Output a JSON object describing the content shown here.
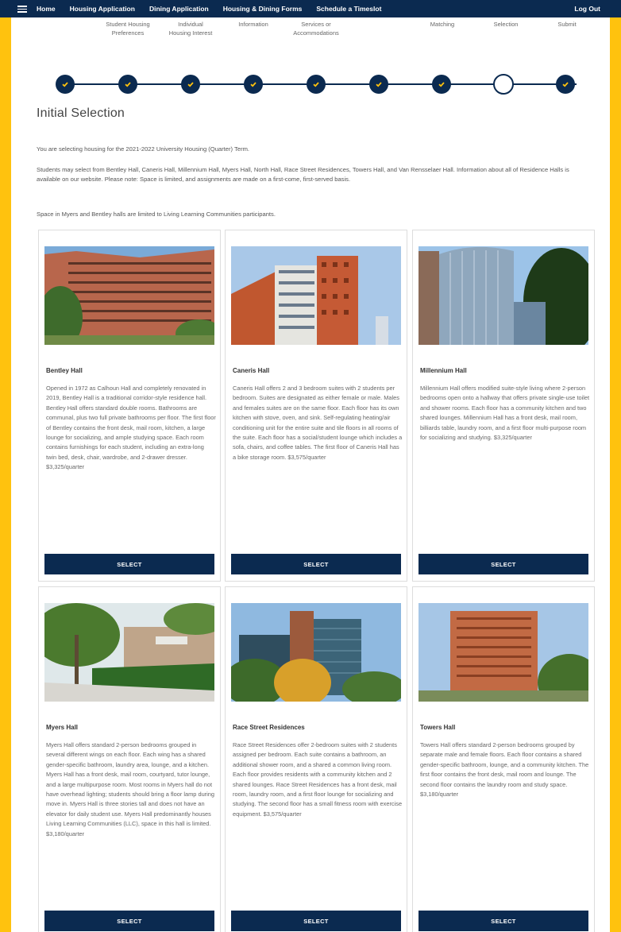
{
  "nav": {
    "links": [
      "Home",
      "Housing Application",
      "Dining Application",
      "Housing & Dining Forms",
      "Schedule a Timeslot"
    ],
    "logout": "Log Out"
  },
  "steps": {
    "labels": [
      "Student Housing Preferences",
      "Individual Housing Interest",
      "Information",
      "Services or Accommodations",
      "Matching",
      "Selection",
      "Submit"
    ]
  },
  "page": {
    "title": "Initial Selection",
    "para1": "You are selecting housing for the 2021-2022 University Housing (Quarter) Term.",
    "para2": "Students may select from Bentley Hall, Caneris Hall, Millennium Hall, Myers Hall, North Hall, Race Street Residences, Towers Hall, and Van Rensselaer Hall. Information about all of Residence Halls is available on our website. Please note: Space is limited, and assignments are made on a first-come, first-served basis.",
    "para3": "Space in Myers and Bentley halls are limited to Living Learning Communities participants."
  },
  "halls": [
    {
      "name": "Bentley Hall",
      "desc": "Opened in 1972 as Calhoun Hall and completely renovated in 2019, Bentley Hall is a traditional corridor-style residence hall. Bentley Hall offers standard double rooms. Bathrooms are communal, plus two full private bathrooms per floor. The first floor of Bentley contains the front desk, mail room, kitchen, a large lounge for socializing, and ample studying space. Each room contains furnishings for each student, including an extra-long twin bed, desk, chair, wardrobe, and 2-drawer dresser. $3,325/quarter",
      "button": "SELECT"
    },
    {
      "name": "Caneris Hall",
      "desc": "Caneris Hall offers 2 and 3 bedroom suites with 2 students per bedroom. Suites are designated as either female or male. Males and females suites are on the same floor. Each floor has its own kitchen with stove, oven, and sink. Self-regulating heating/air conditioning unit for the entire suite and tile floors in all rooms of the suite. Each floor has a social/student lounge which includes a sofa, chairs, and coffee tables. The first floor of Caneris Hall has a bike storage room. $3,575/quarter",
      "button": "SELECT"
    },
    {
      "name": "Millennium Hall",
      "desc": "Millennium Hall offers modified suite-style living where 2-person bedrooms open onto a hallway that offers private single-use toilet and shower rooms. Each floor has a community kitchen and two shared lounges. Millennium Hall has a front desk, mail room, billiards table, laundry room, and a first floor multi-purpose room for socializing and studying. $3,325/quarter",
      "button": "SELECT"
    },
    {
      "name": "Myers Hall",
      "desc": "Myers Hall offers standard 2-person bedrooms grouped in several different wings on each floor. Each wing has a shared gender-specific bathroom, laundry area, lounge, and a kitchen. Myers Hall has a front desk, mail room, courtyard, tutor lounge, and a large multipurpose room. Most rooms in Myers hall do not have overhead lighting; students should bring a floor lamp during move in. Myers Hall is three stories tall and does not have an elevator for daily student use. Myers Hall predominantly houses Living Learning Communities (LLC), space in this hall is limited. $3,180/quarter",
      "button": "SELECT"
    },
    {
      "name": "Race Street Residences",
      "desc": "Race Street Residences offer 2-bedroom suites with 2 students assigned per bedroom. Each suite contains a bathroom, an additional shower room, and a shared a common living room. Each floor provides residents with a community kitchen and 2 shared lounges. Race Street Residences has a front desk, mail room, laundry room, and a first floor lounge for socializing and studying. The second floor has a small fitness room with exercise equipment. $3,575/quarter",
      "button": "SELECT"
    },
    {
      "name": "Towers Hall",
      "desc": "Towers Hall offers standard 2-person bedrooms grouped by separate male and female floors. Each floor contains a shared gender-specific bathroom, lounge, and a community kitchen. The first floor contains the front desk, mail room and lounge. The second floor contains the laundry room and study space. $3,180/quarter",
      "button": "SELECT"
    }
  ],
  "colors": {
    "accent": "#0B2A50",
    "frame": "#FFC20E"
  }
}
